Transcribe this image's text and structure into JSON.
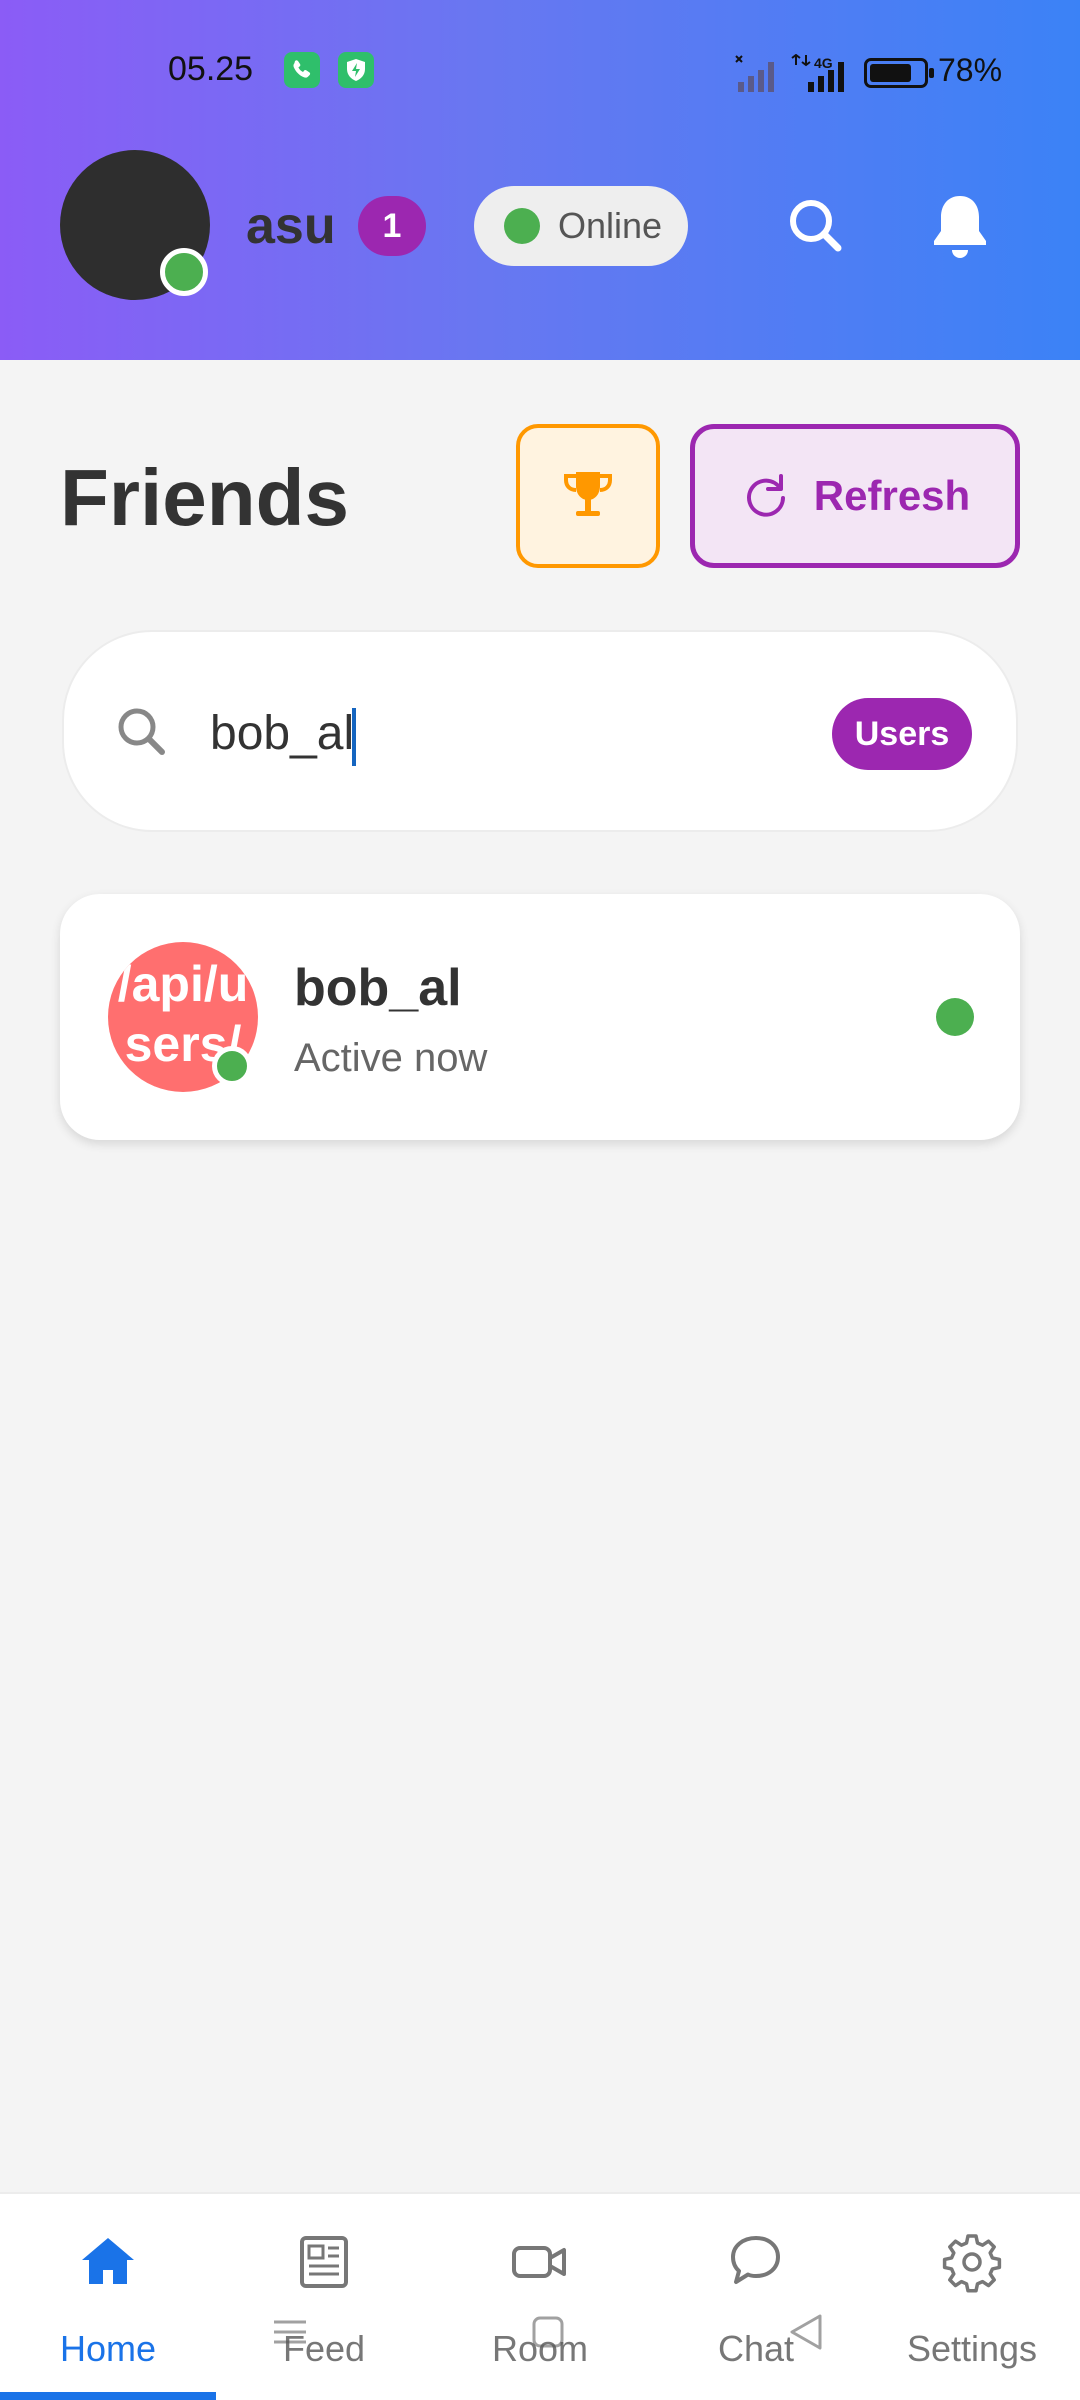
{
  "status_bar": {
    "time": "05.25",
    "network_label": "4G",
    "battery_level": 0.78,
    "battery_text": "78%"
  },
  "header": {
    "username": "asu",
    "notification_count": "1",
    "presence_label": "Online",
    "colors": {
      "gradient_start": "#8b5cf6",
      "gradient_end": "#3b82f6",
      "online": "#4caf50",
      "badge": "#9c27b0"
    }
  },
  "page": {
    "title": "Friends",
    "refresh_label": "Refresh"
  },
  "search": {
    "value": "bob_al",
    "placeholder": "",
    "chip_label": "Users"
  },
  "friends": [
    {
      "avatar_text": "/api/users/",
      "name": "bob_al",
      "status": "Active now"
    }
  ],
  "nav": {
    "items": [
      {
        "label": "Home",
        "icon": "home-icon"
      },
      {
        "label": "Feed",
        "icon": "newspaper-icon"
      },
      {
        "label": "Room",
        "icon": "video-camera-icon"
      },
      {
        "label": "Chat",
        "icon": "chat-bubble-icon"
      },
      {
        "label": "Settings",
        "icon": "gear-icon"
      }
    ],
    "active_index": 0
  }
}
